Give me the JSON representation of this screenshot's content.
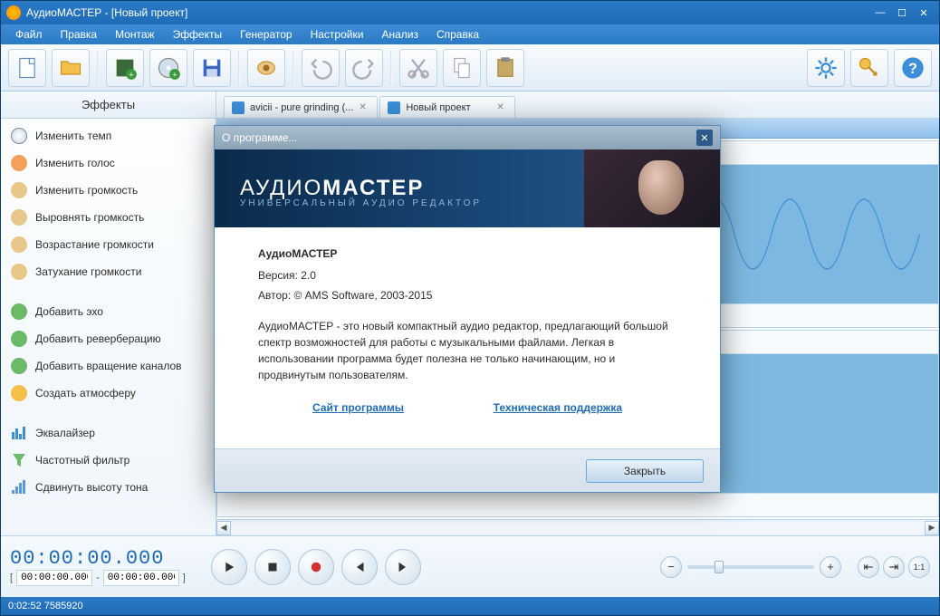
{
  "window": {
    "title": "АудиоМАСТЕР - [Новый проект]"
  },
  "menu": {
    "items": [
      "Файл",
      "Правка",
      "Монтаж",
      "Эффекты",
      "Генератор",
      "Настройки",
      "Анализ",
      "Справка"
    ]
  },
  "sidebar": {
    "header": "Эффекты",
    "groups": [
      [
        "Изменить темп",
        "Изменить голос",
        "Изменить громкость",
        "Выровнять громкость",
        "Возрастание громкости",
        "Затухание громкости"
      ],
      [
        "Добавить эхо",
        "Добавить реверберацию",
        "Добавить вращение каналов",
        "Создать атмосферу"
      ],
      [
        "Эквалайзер",
        "Частотный фильтр",
        "Сдвинуть высоту тона"
      ]
    ]
  },
  "tabs": [
    {
      "label": "avicii - pure grinding (..."
    },
    {
      "label": "Новый проект"
    }
  ],
  "time": {
    "current": "00:00:00.000",
    "range_start": "00:00:00.000",
    "range_end": "00:00:00.000",
    "range_sep": "-",
    "bracket_open": "[",
    "bracket_close": "]"
  },
  "status": "0:02:52 7585920",
  "about": {
    "dialog_title": "О программе...",
    "banner_title_light": "АУДИО",
    "banner_title_bold": "МАСТЕР",
    "banner_sub": "УНИВЕРСАЛЬНЫЙ АУДИО РЕДАКТОР",
    "product": "АудиоМАСТЕР",
    "version": "Версия: 2.0",
    "author": "Автор: © AMS Software, 2003-2015",
    "desc": "АудиоМАСТЕР - это новый компактный аудио редактор, предлагающий большой спектр возможностей для работы с музыкальными файлами. Легкая в использовании программа будет полезна не только начинающим, но и продвинутым пользователям.",
    "link_site": "Сайт программы",
    "link_support": "Техническая поддержка",
    "close_btn": "Закрыть"
  }
}
